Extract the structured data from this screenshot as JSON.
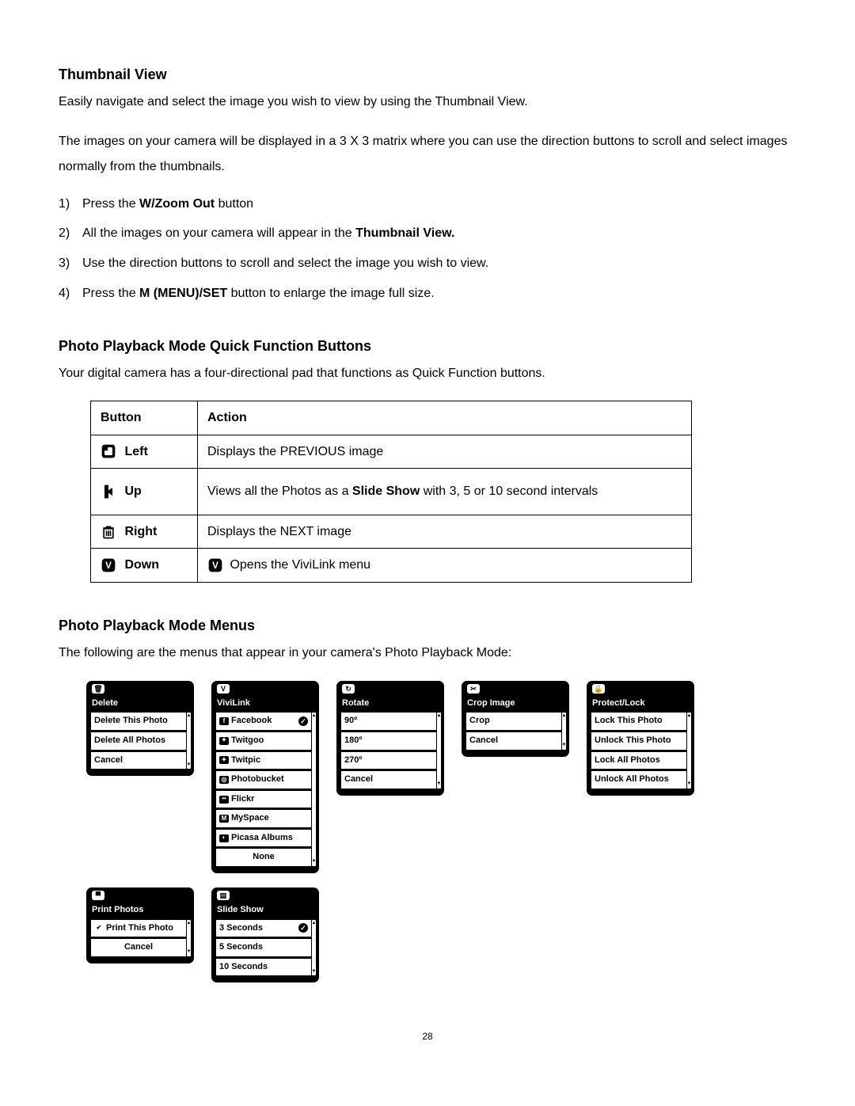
{
  "section1": {
    "heading": "Thumbnail View",
    "p1": "Easily navigate and select the image you wish to view by using the Thumbnail View.",
    "p2": "The images on your camera will be displayed in a 3 X 3 matrix where you can use the direction buttons to scroll and select images normally from the thumbnails."
  },
  "steps": {
    "s1n": "1)",
    "s1a": "Press the ",
    "s1b": "W/Zoom Out",
    "s1c": " button",
    "s2n": "2)",
    "s2a": "All the images on your camera will appear in the ",
    "s2b": "Thumbnail View.",
    "s3n": "3)",
    "s3": "Use the direction buttons to scroll and select the image you wish to view.",
    "s4n": "4)",
    "s4a": "Press the ",
    "s4b": "M (MENU)/SET",
    "s4c": " button to enlarge the image full size."
  },
  "section2": {
    "heading": "Photo Playback Mode Quick Function Buttons",
    "p": "Your digital camera has a four-directional pad that functions as Quick Function buttons."
  },
  "table": {
    "h1": "Button",
    "h2": "Action",
    "r1b": "Left",
    "r1a": "Displays the PREVIOUS image",
    "r2b": "Up",
    "r2a_pre": "Views all the Photos as a ",
    "r2a_b": "Slide Show",
    "r2a_post": " with 3, 5 or 10 second intervals",
    "r3b": "Right",
    "r3a": "Displays the NEXT image",
    "r4b": "Down",
    "r4a": " Opens the ViviLink menu"
  },
  "section3": {
    "heading": "Photo Playback Mode Menus",
    "p": "The following are the menus that appear in your camera's Photo Playback Mode:"
  },
  "menus": {
    "delete": {
      "title": "Delete",
      "items": [
        "Delete This Photo",
        "Delete All Photos",
        "Cancel"
      ]
    },
    "vivilink": {
      "title": "ViviLink",
      "items": [
        "Facebook",
        "Twitgoo",
        "Twitpic",
        "Photobucket",
        "Flickr",
        "MySpace",
        "Picasa Albums",
        "None"
      ],
      "checked": 0
    },
    "rotate": {
      "title": "Rotate",
      "items": [
        "90º",
        "180º",
        "270º",
        "Cancel"
      ]
    },
    "crop": {
      "title": "Crop Image",
      "items": [
        "Crop",
        "Cancel"
      ]
    },
    "protect": {
      "title": "Protect/Lock",
      "items": [
        "Lock This Photo",
        "Unlock This Photo",
        "Lock All Photos",
        "Unlock All Photos"
      ]
    },
    "print": {
      "title": "Print Photos",
      "items": [
        "Print This Photo",
        "Cancel"
      ],
      "leadIcon": 0
    },
    "slide": {
      "title": "Slide Show",
      "items": [
        "3 Seconds",
        "5 Seconds",
        "10 Seconds"
      ],
      "checked": 0
    }
  },
  "pageNumber": "28"
}
